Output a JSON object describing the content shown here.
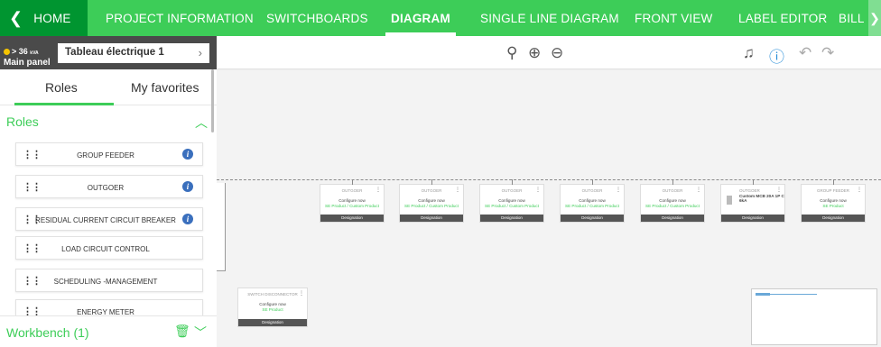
{
  "nav": {
    "home": "HOME",
    "items": [
      "PROJECT INFORMATION",
      "SWITCHBOARDS",
      "DIAGRAM",
      "SINGLE LINE DIAGRAM",
      "FRONT VIEW",
      "LABEL EDITOR",
      "BILL"
    ],
    "active": "DIAGRAM"
  },
  "panel": {
    "kva": "> 36",
    "kva_unit": "kVA",
    "main_label": "Main panel",
    "select_value": "Tableau électrique 1"
  },
  "sidebar": {
    "tabs": [
      "Roles",
      "My favorites"
    ],
    "active_tab": "Roles",
    "roles_header": "Roles",
    "roles": [
      {
        "label": "GROUP FEEDER",
        "info": true
      },
      {
        "label": "OUTGOER",
        "info": true
      },
      {
        "label": "RESIDUAL CURRENT CIRCUIT BREAKER",
        "info": true
      },
      {
        "label": "LOAD CIRCUIT CONTROL",
        "info": false
      },
      {
        "label": "SCHEDULING -MANAGEMENT",
        "info": false
      },
      {
        "label": "ENERGY METER",
        "info": false
      }
    ],
    "workbench": "Workbench (1)"
  },
  "canvas": {
    "cards": [
      {
        "role": "OUTGOER",
        "config": "Configure now",
        "product": "SE Product / Custom Product",
        "designation": "Designation"
      },
      {
        "role": "OUTGOER",
        "config": "Configure now",
        "product": "SE Product / Custom Product",
        "designation": "Designation"
      },
      {
        "role": "OUTGOER",
        "config": "Configure now",
        "product": "SE Product / Custom Product",
        "designation": "Designation"
      },
      {
        "role": "OUTGOER",
        "config": "Configure now",
        "product": "SE Product / Custom Product",
        "designation": "Designation"
      },
      {
        "role": "OUTGOER",
        "config": "Configure now",
        "product": "SE Product / Custom Product",
        "designation": "Designation"
      },
      {
        "role": "OUTGOER",
        "config": "Custom MCB 20A 1P C 6kA",
        "product": "",
        "designation": "Designation"
      },
      {
        "role": "GROUP FEEDER",
        "config": "Configure now",
        "product": "SE Product",
        "designation": "Designation"
      }
    ],
    "switch_card": {
      "role": "SWITCH DISCONNECTOR",
      "config": "Configure now",
      "product": "SE Product",
      "designation": "Designation"
    }
  }
}
